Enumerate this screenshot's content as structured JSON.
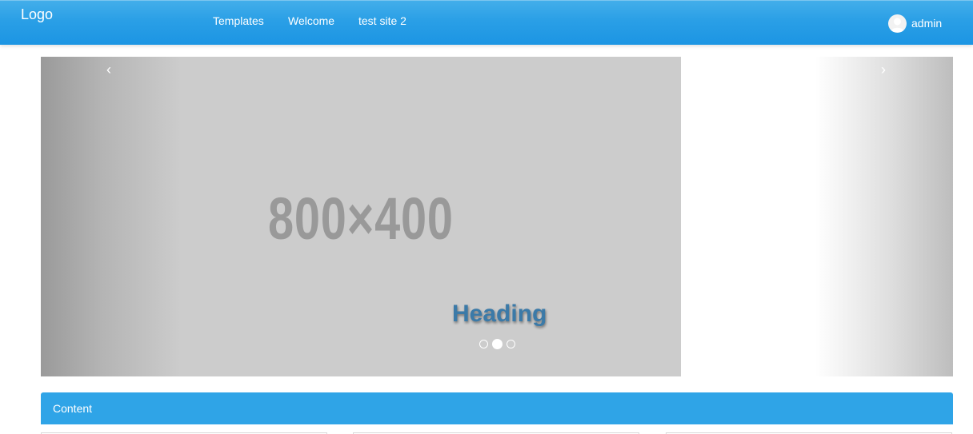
{
  "navbar": {
    "logo": "Logo",
    "items": [
      {
        "label": "Templates"
      },
      {
        "label": "Welcome"
      },
      {
        "label": "test site 2"
      }
    ],
    "user": {
      "name": "admin",
      "avatar_icon": "user-avatar-icon"
    }
  },
  "carousel": {
    "placeholder_text": "800×400",
    "caption_heading": "Heading",
    "prev_icon": "chevron-left-icon",
    "next_icon": "chevron-right-icon",
    "prev_glyph": "‹",
    "next_glyph": "›",
    "slides_count": 3,
    "active_slide": 2
  },
  "panel": {
    "title": "Content"
  },
  "colors": {
    "navbar": "#2a9fe6",
    "panel_header": "#2fa4e7",
    "slide_bg": "#cccccc",
    "caption": "#3b7aa8"
  }
}
